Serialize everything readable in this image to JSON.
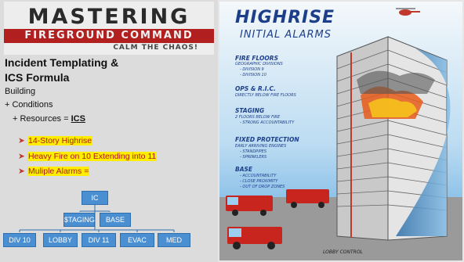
{
  "banner": {
    "title": "MASTERING",
    "subtitle": "FIREGROUND COMMAND",
    "tagline": "CALM THE CHAOS!"
  },
  "content": {
    "heading_line1": "Incident Templating &",
    "heading_line2": "ICS Formula",
    "line_building": "Building",
    "line_conditions": "+ Conditions",
    "line_resources_prefix": "+ Resources = ",
    "line_resources_ics": "ICS",
    "bullets": [
      "14-Story Highrise",
      "Heavy Fire on 10 Extending into 11",
      "Muliple Alarms ="
    ]
  },
  "org_chart": {
    "top": "IC",
    "level2": [
      "$TAGING",
      "BASE"
    ],
    "level3": [
      "DIV 10",
      "LOBBY",
      "DIV 11",
      "EVAC",
      "MED"
    ]
  },
  "poster": {
    "title": "HIGHRISE",
    "subtitle": "INITIAL ALARMS",
    "sections": [
      {
        "title": "FIRE FLOORS",
        "lines": [
          "GEOGRAPHIC DIVISIONS",
          "- DIVISION 9",
          "- DIVISION 10"
        ]
      },
      {
        "title": "OPS & R.I.C.",
        "lines": [
          "DIRECTLY BELOW FIRE FLOORS"
        ]
      },
      {
        "title": "STAGING",
        "lines": [
          "2 FLOORS BELOW FIRE",
          "- STRONG ACCOUNTABILITY"
        ]
      },
      {
        "title": "FIXED PROTECTION",
        "lines": [
          "EARLY ARRIVING ENGINES",
          "- STANDPIPES",
          "- SPRINKLERS"
        ]
      },
      {
        "title": "BASE",
        "lines": [
          "- ACCOUNTABILITY",
          "- CLOSE PROXIMITY",
          "- OUT OF DROP ZONES"
        ]
      }
    ],
    "lobby_label": "LOBBY CONTROL"
  },
  "colors": {
    "banner_red": "#b11f1f",
    "highlight_yellow": "#ffee00",
    "bullet_red": "#b01818",
    "org_blue": "#4a8fd1",
    "poster_blue": "#1d3f8a"
  }
}
